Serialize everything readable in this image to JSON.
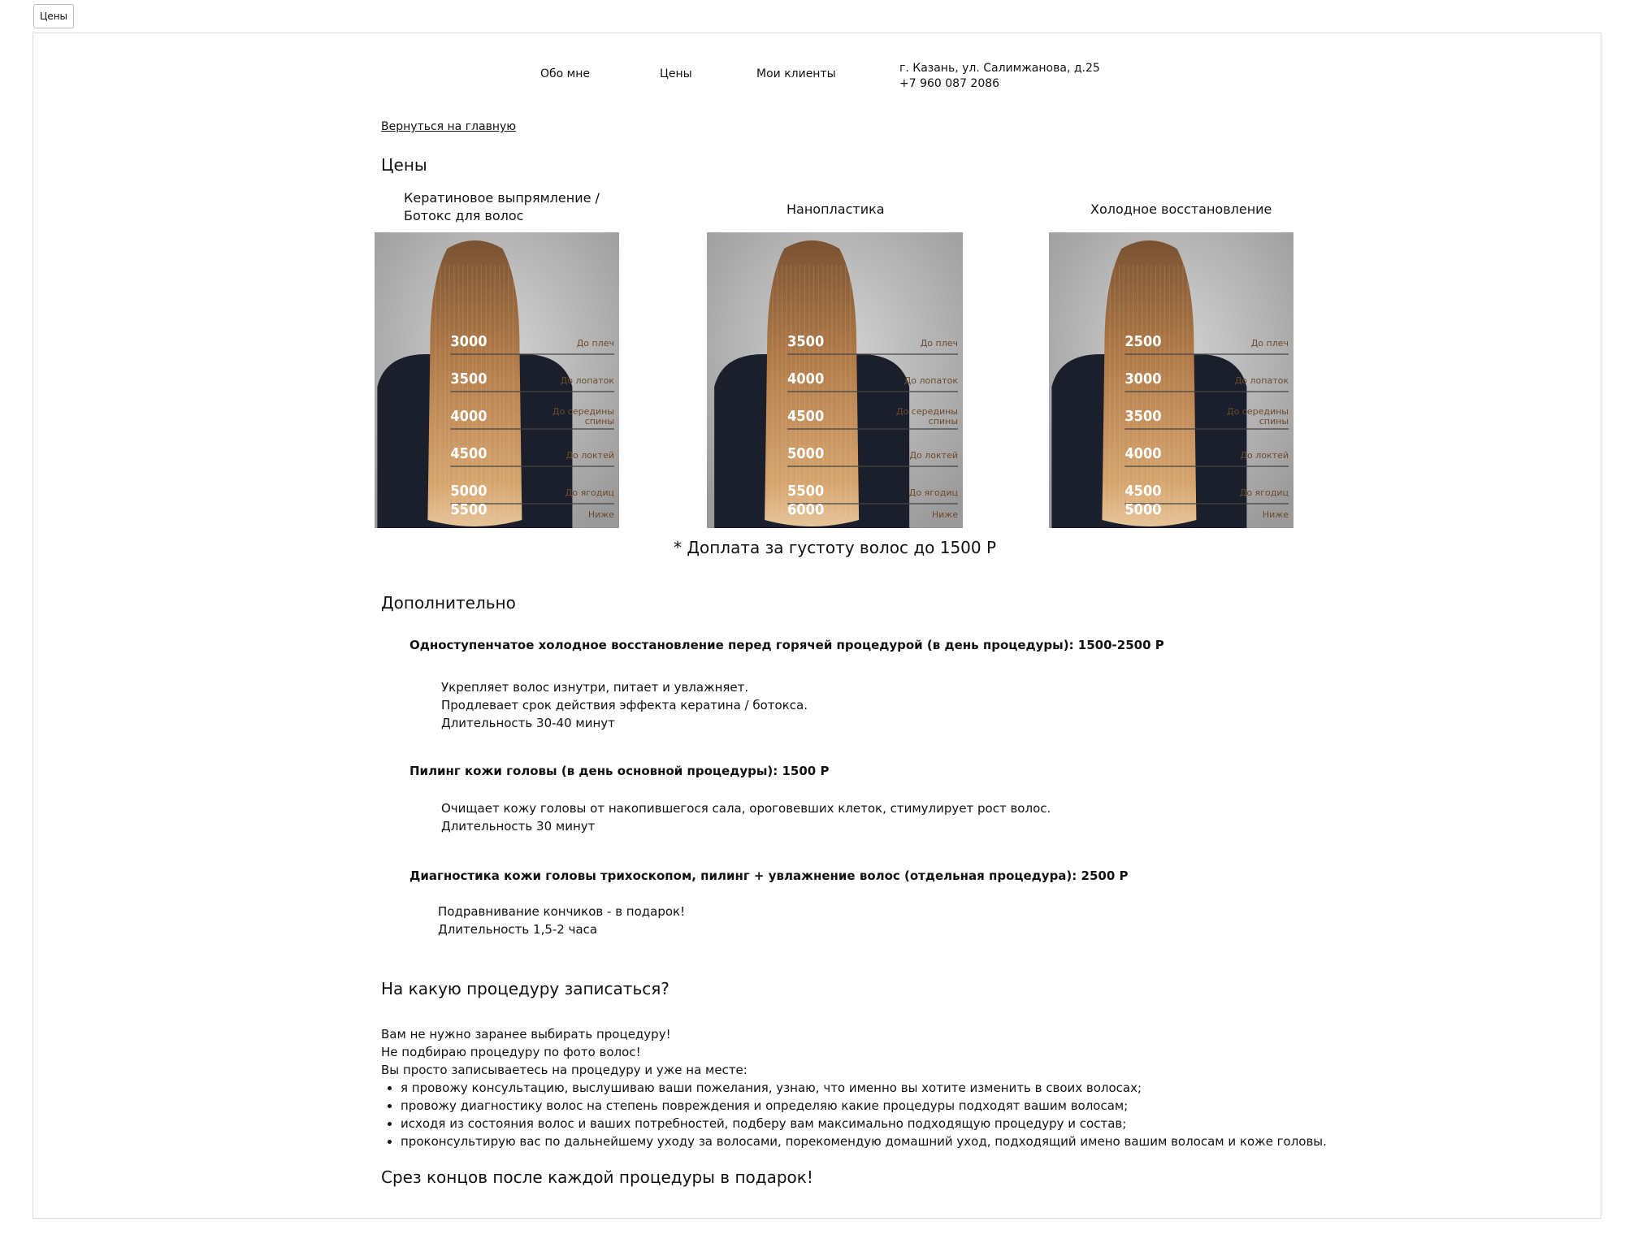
{
  "page_label": "Цены",
  "nav": {
    "about": "Обо мне",
    "prices": "Цены",
    "clients": "Мои клиенты"
  },
  "contact": {
    "address": "г. Казань, ул. Салимжанова, д.25",
    "phone": "+7 960 087 2086"
  },
  "back_link": "Вернуться на главную",
  "prices_heading": "Цены",
  "cards": [
    {
      "title_line1": "Кератиновое выпрямление /",
      "title_line2": "Ботокс для волос",
      "prices": [
        "3000",
        "3500",
        "4000",
        "4500",
        "5000",
        "5500"
      ],
      "lengths": [
        "До плеч",
        "До лопаток",
        "До середины спины",
        "До локтей",
        "До ягодиц",
        "Ниже"
      ]
    },
    {
      "title_line1": "Нанопластика",
      "prices": [
        "3500",
        "4000",
        "4500",
        "5000",
        "5500",
        "6000"
      ],
      "lengths": [
        "До плеч",
        "До лопаток",
        "До середины спины",
        "До локтей",
        "До ягодиц",
        "Ниже"
      ]
    },
    {
      "title_line1": "Холодное восстановление",
      "prices": [
        "2500",
        "3000",
        "3500",
        "4000",
        "4500",
        "5000"
      ],
      "lengths": [
        "До плеч",
        "До лопаток",
        "До середины спины",
        "До локтей",
        "До ягодиц",
        "Ниже"
      ]
    }
  ],
  "surcharge": "* Доплата за густоту волос до 1500 Р",
  "extra_heading": "Дополнительно",
  "extras": [
    {
      "title": "Одноступенчатое холодное восстановление перед горячей процедурой (в день процедуры): 1500-2500 Р",
      "lines": [
        "Укрепляет волос изнутри, питает и увлажняет.",
        "Продлевает срок действия эффекта кератина / ботокса.",
        "Длительность 30-40 минут"
      ]
    },
    {
      "title": "Пилинг кожи головы (в день основной процедуры): 1500 Р",
      "lines": [
        "Очищает кожу головы от накопившегося сала, ороговевших клеток, стимулирует рост волос.",
        "Длительность 30 минут"
      ]
    },
    {
      "title": "Диагностика кожи головы трихоскопом, пилинг + увлажнение волос (отдельная процедура): 2500 Р",
      "lines": [
        "Подравнивание кончиков - в подарок!",
        "Длительность 1,5-2 часа"
      ]
    }
  ],
  "which_heading": "На какую процедуру записаться?",
  "intro_lines": [
    "Вам не нужно заранее выбирать процедуру!",
    "Не подбираю процедуру по фото волос!",
    "Вы просто записываетесь на процедуру и уже на месте:"
  ],
  "bullets": [
    "я провожу консультацию, выслушиваю ваши пожелания, узнаю, что именно вы хотите изменить в своих волосах;",
    "провожу диагностику волос на степень повреждения и определяю какие процедуры подходят вашим волосам;",
    "исходя из состояния волос и ваших потребностей, подберу вам максимально подходящую процедуру и состав;",
    "проконсультирую вас по дальнейшему уходу за волосами, порекомендую домашний уход, подходящий имено вашим волосам и коже головы."
  ],
  "gift": "Срез концов после каждой процедуры в подарок!"
}
